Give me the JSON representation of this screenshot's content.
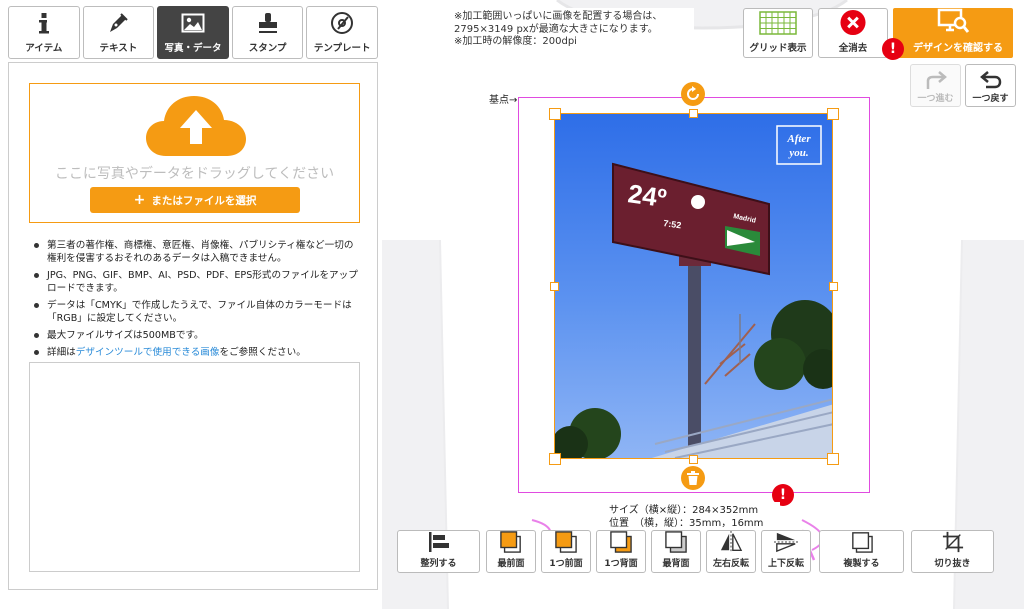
{
  "tabs": [
    {
      "label": "アイテム",
      "icon": "info-icon"
    },
    {
      "label": "テキスト",
      "icon": "pen-icon"
    },
    {
      "label": "写真・データ",
      "icon": "image-icon",
      "active": true
    },
    {
      "label": "スタンプ",
      "icon": "stamp-icon"
    },
    {
      "label": "テンプレート",
      "icon": "disc-icon"
    }
  ],
  "upload": {
    "drop_text": "ここに写真やデータをドラッグしてください",
    "select_button": "またはファイルを選択"
  },
  "notes": [
    "第三者の著作権、商標権、意匠権、肖像権、パブリシティ権など一切の権利を侵害するおそれのあるデータは入稿できません。",
    "JPG、PNG、GIF、BMP、AI、PSD、PDF、EPS形式のファイルをアップロードできます。",
    "データは「CMYK」で作成したうえで、ファイル自体のカラーモードは「RGB」に設定してください。",
    "最大ファイルサイズは500MBです。"
  ],
  "detail_note": {
    "prefix": "詳細は",
    "link": "デザインツールで使用できる画像",
    "suffix": "をご参照ください。"
  },
  "info": {
    "line1": "※加工範囲いっぱいに画像を配置する場合は、",
    "line2": "2795×3149 pxが最適な大きさになります。",
    "line3": "※加工時の解像度：200dpi"
  },
  "toolbar": {
    "grid": "グリッド表示",
    "clear": "全消去",
    "confirm": "デザインを確認する",
    "redo": "一つ進む",
    "undo": "一つ戻す"
  },
  "canvas": {
    "base_label": "基点→"
  },
  "photo": {
    "temperature": "24º",
    "time": "7:52",
    "city": "Madrid",
    "after_line1": "After",
    "after_line2": "you."
  },
  "size_info": {
    "size_line": "サイズ（横×縦）：284×352mm",
    "pos_line": "位置　（横，縦）：35mm，16mm"
  },
  "bottom_buttons": {
    "align": "整列する",
    "front": "最前面",
    "forward": "1つ前面",
    "backward": "1つ背面",
    "back": "最背面",
    "flip_h": "左右反転",
    "flip_v": "上下反転",
    "duplicate": "複製する",
    "crop": "切り抜き"
  },
  "colors": {
    "accent": "#f59b13",
    "print_area": "#e04be0",
    "alert": "#e60012",
    "link": "#2a8bd8"
  }
}
